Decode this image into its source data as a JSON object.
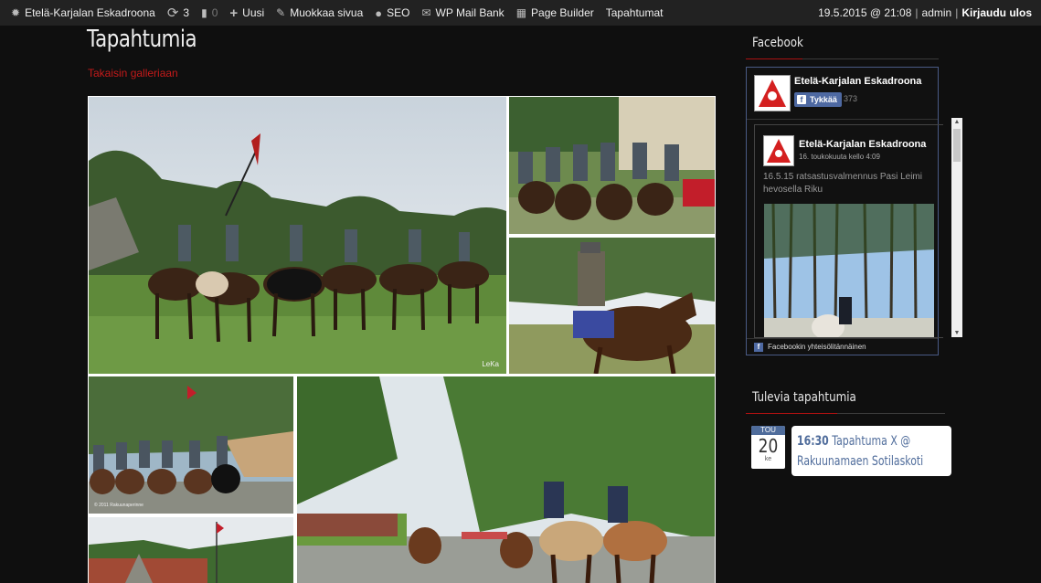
{
  "adminbar": {
    "site_name": "Etelä-Karjalan Eskadroona",
    "updates_count": "3",
    "comments_count": "0",
    "new_label": "Uusi",
    "edit_label": "Muokkaa sivua",
    "seo_label": "SEO",
    "mail_label": "WP Mail Bank",
    "builder_label": "Page Builder",
    "events_label": "Tapahtumat",
    "datetime": "19.5.2015 @ 21:08",
    "separator": "|",
    "user": "admin",
    "logout_label": "Kirjaudu ulos"
  },
  "main": {
    "title": "Tapahtumia",
    "back_link": "Takaisin galleriaan",
    "photos": [
      {
        "watermark": "LeKa"
      },
      {
        "watermark": ""
      },
      {
        "watermark": ""
      },
      {
        "watermark": "© 2011 Rakuunaperinne"
      },
      {
        "watermark": ""
      },
      {
        "watermark": ""
      }
    ]
  },
  "sidebar": {
    "facebook": {
      "title": "Facebook",
      "page_name": "Etelä-Karjalan Eskadroona",
      "like_label": "Tykkää",
      "like_count": "373",
      "post_author": "Etelä-Karjalan Eskadroona",
      "post_date": "16. toukokuuta kello 4:09",
      "post_text": "16.5.15 ratsastusvalmennus Pasi Leimi hevosella Riku",
      "footer": "Facebookin yhteisölitännäinen"
    },
    "events": {
      "title": "Tulevia tapahtumia",
      "month": "TOU",
      "day": "20",
      "weekday": "ke",
      "time": "16:30",
      "event_title": "Tapahtuma X @ Rakuunamaen Sotilaskoti"
    }
  },
  "colors": {
    "accent_red": "#c41a1a",
    "event_blue": "#4f6c9b",
    "facebook_blue": "#4e69a2"
  }
}
